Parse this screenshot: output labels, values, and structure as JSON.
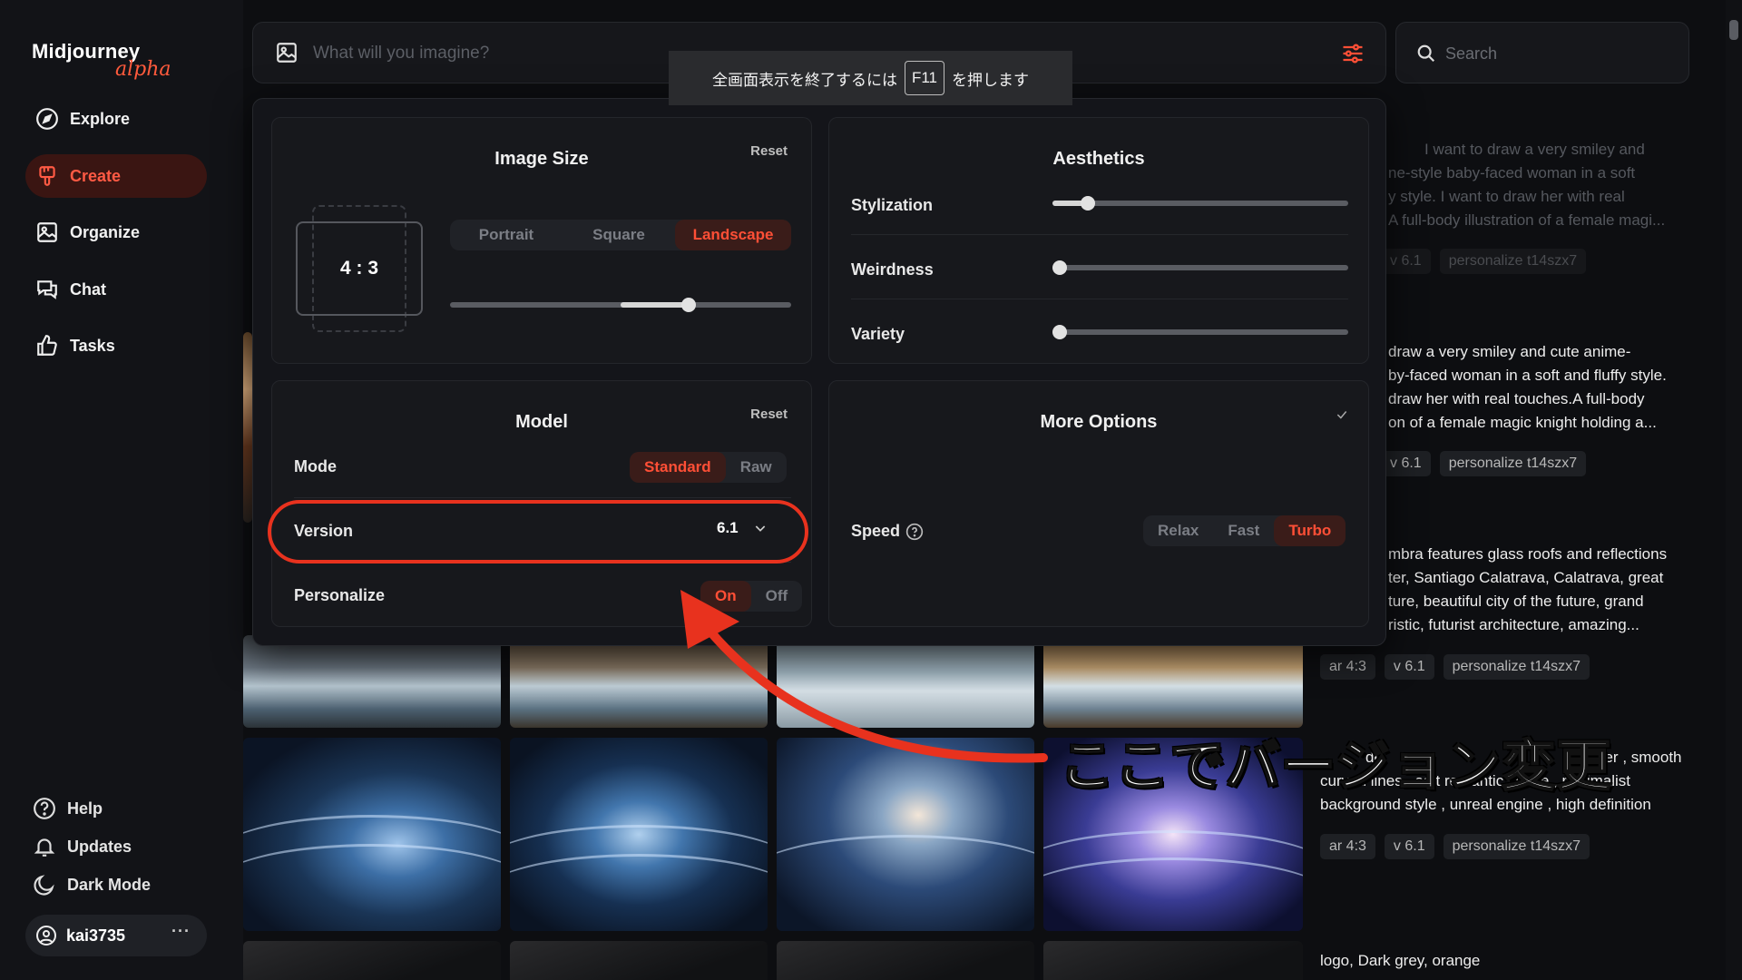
{
  "app": {
    "logo_main": "Midjourney",
    "logo_sub": "alpha"
  },
  "sidebar": {
    "items": [
      {
        "label": "Explore",
        "icon": "compass-icon"
      },
      {
        "label": "Create",
        "icon": "brush-icon",
        "active": true
      },
      {
        "label": "Organize",
        "icon": "image-icon"
      },
      {
        "label": "Chat",
        "icon": "chat-icon"
      },
      {
        "label": "Tasks",
        "icon": "thumbs-up-icon"
      }
    ],
    "bottom": [
      {
        "label": "Help",
        "icon": "help-icon"
      },
      {
        "label": "Updates",
        "icon": "bell-icon"
      },
      {
        "label": "Dark Mode",
        "icon": "moon-icon"
      }
    ],
    "user": {
      "name": "kai3735",
      "more": "···"
    }
  },
  "imagine": {
    "placeholder": "What will you imagine?"
  },
  "search": {
    "placeholder": "Search"
  },
  "toast": {
    "before": "全画面表示を終了するには",
    "key": "F11",
    "after": "を押します"
  },
  "settings": {
    "image_size": {
      "title": "Image Size",
      "reset": "Reset",
      "ratio": "4 : 3",
      "orientations": [
        "Portrait",
        "Square",
        "Landscape"
      ],
      "selected": "Landscape",
      "slider_value": 0.7
    },
    "aesthetics": {
      "title": "Aesthetics",
      "sliders": [
        {
          "label": "Stylization",
          "value": 0.12
        },
        {
          "label": "Weirdness",
          "value": 0.0
        },
        {
          "label": "Variety",
          "value": 0.0
        }
      ]
    },
    "model": {
      "title": "Model",
      "reset": "Reset",
      "mode_label": "Mode",
      "modes": [
        "Standard",
        "Raw"
      ],
      "mode_selected": "Standard",
      "version_label": "Version",
      "version_value": "6.1",
      "personalize_label": "Personalize",
      "personalize_options": [
        "On",
        "Off"
      ],
      "personalize_selected": "On"
    },
    "more_options": {
      "title": "More Options",
      "speed_label": "Speed",
      "speeds": [
        "Relax",
        "Fast",
        "Turbo"
      ],
      "speed_selected": "Turbo"
    }
  },
  "prompts": [
    {
      "lines": [
        "I want to draw a very smiley and",
        "ne-style baby-faced woman in a soft",
        "y style. I want to draw her with real",
        "A full-body illustration of a female magi..."
      ],
      "tags": [
        "v 6.1",
        "personalize t14szx7"
      ],
      "faded": true
    },
    {
      "lines": [
        "draw a very smiley and cute anime-",
        "by-faced woman in a soft and fluffy style.",
        "draw her with real touches.A full-body",
        "on of a female magic knight holding a..."
      ],
      "tags": [
        "v 6.1",
        "personalize t14szx7"
      ]
    },
    {
      "lines": [
        "mbra features glass roofs and reflections",
        "ter, Santiago Calatrava, Calatrava, great",
        "ture, beautiful city of the future, grand",
        "ristic, futurist architecture, amazing..."
      ],
      "tags": [
        "ar 4:3",
        "v 6.1",
        "personalize t14szx7"
      ]
    },
    {
      "lines": [
        "de",
        "silver , smooth",
        "curved lines , soft romantic scene , minimalist",
        "background style , unreal engine , high definition"
      ],
      "tags": [
        "ar 4:3",
        "v 6.1",
        "personalize t14szx7"
      ]
    },
    {
      "lines": [
        "logo, Dark grey, orange"
      ],
      "tags": []
    }
  ],
  "annotation": {
    "text": "ここでバージョン変更"
  },
  "colors": {
    "accent": "#ff4f36",
    "highlight": "#e8321e",
    "background": "#0d0e11"
  }
}
